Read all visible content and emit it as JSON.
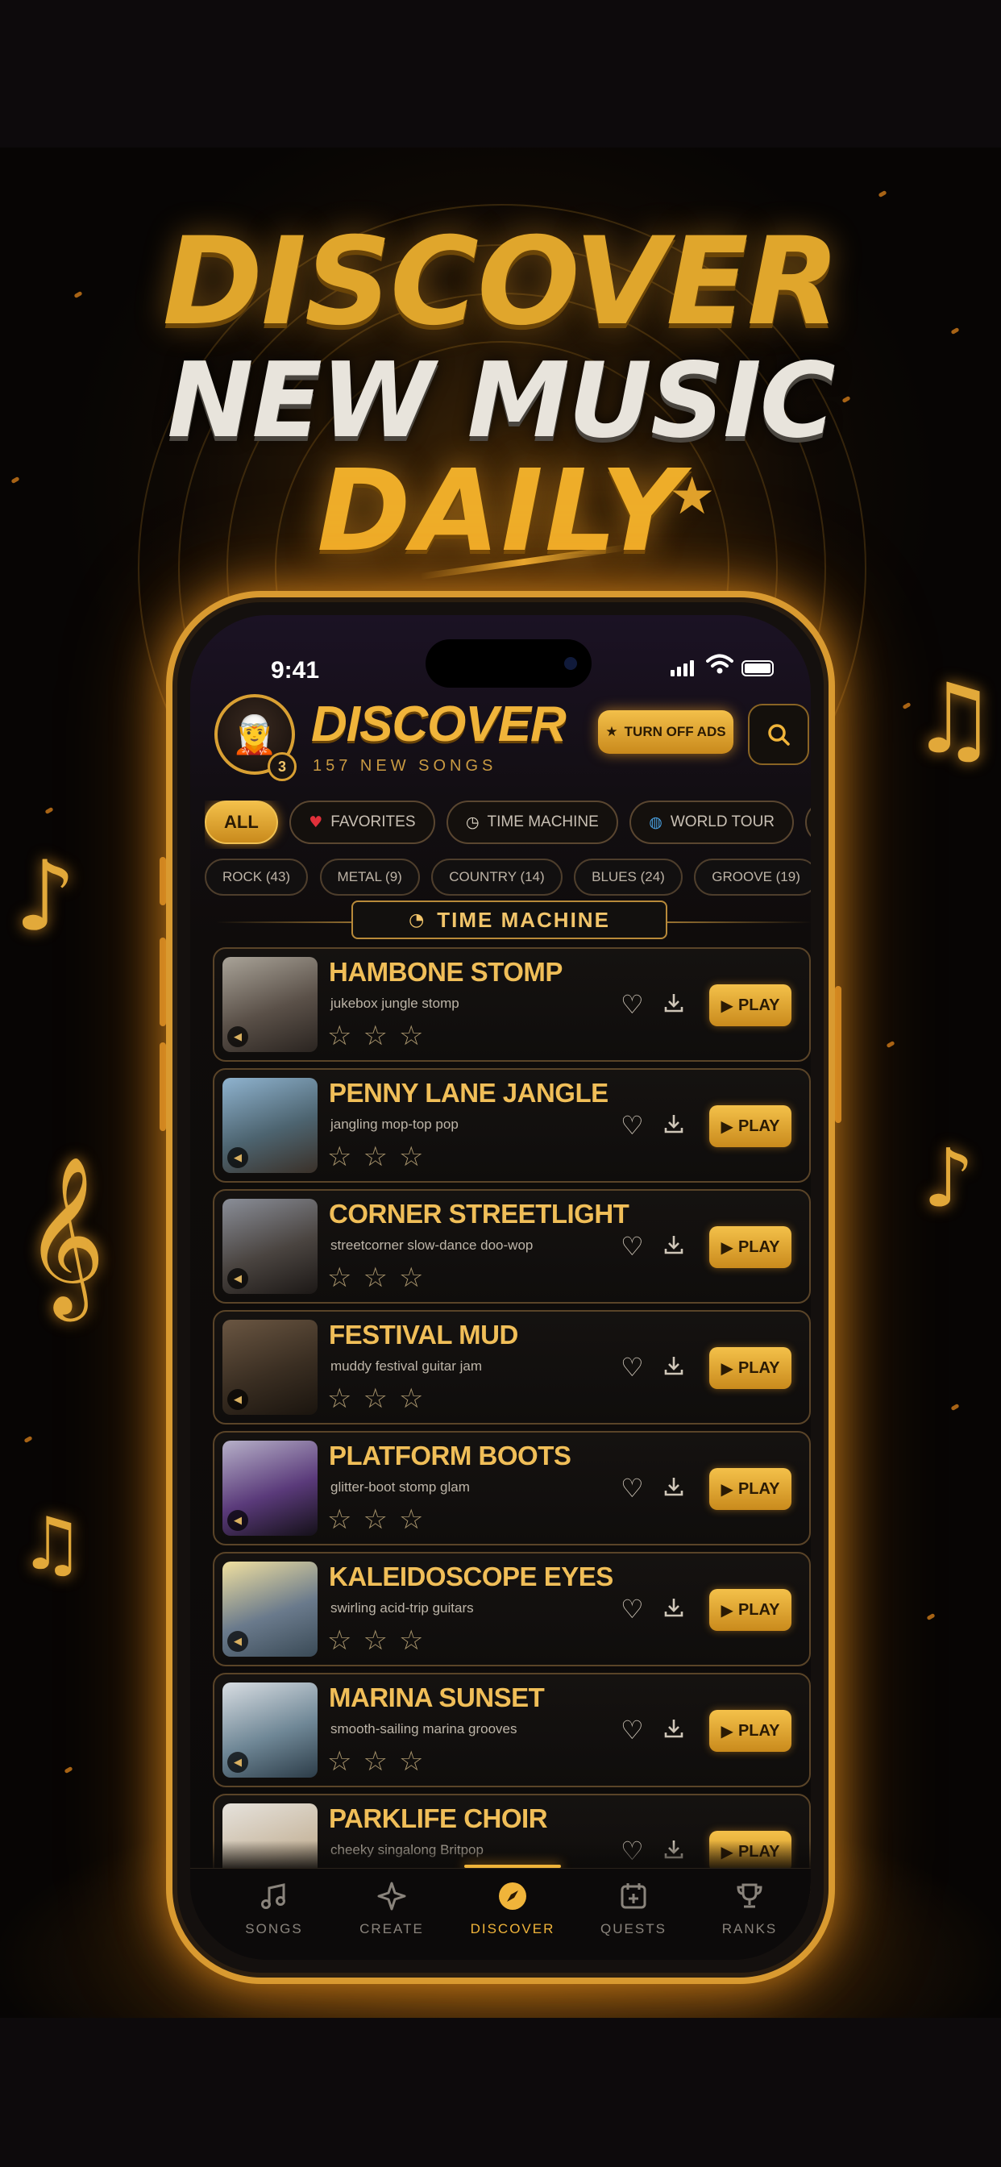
{
  "headline": {
    "line1": "DISCOVER",
    "line2": "NEW MUSIC",
    "line3": "DAILY"
  },
  "status": {
    "time": "9:41"
  },
  "header": {
    "title": "DISCOVER",
    "subtitle": "157 NEW SONGS",
    "level": "3",
    "ads_button": "TURN OFF ADS"
  },
  "categories": [
    {
      "label": "ALL",
      "icon": ""
    },
    {
      "label": "FAVORITES",
      "icon": "heart-icon"
    },
    {
      "label": "TIME MACHINE",
      "icon": "clock-icon"
    },
    {
      "label": "WORLD TOUR",
      "icon": "globe-icon"
    },
    {
      "label": "C",
      "icon": "card-icon"
    }
  ],
  "genres": [
    "ROCK (43)",
    "METAL (9)",
    "COUNTRY (14)",
    "BLUES (24)",
    "GROOVE (19)",
    "WO"
  ],
  "section": {
    "label": "TIME MACHINE"
  },
  "songs": [
    {
      "title": "HAMBONE STOMP",
      "desc": "jukebox jungle stomp",
      "play": "PLAY",
      "colors": [
        "#a9a398",
        "#5a5048",
        "#2a2420"
      ]
    },
    {
      "title": "PENNY LANE JANGLE",
      "desc": "jangling mop-top pop",
      "play": "PLAY",
      "colors": [
        "#8fb3cf",
        "#4d6470",
        "#3a3028"
      ]
    },
    {
      "title": "CORNER STREETLIGHT",
      "desc": "streetcorner slow-dance doo-wop",
      "play": "PLAY",
      "colors": [
        "#8a8e98",
        "#4a4440",
        "#1c1816"
      ]
    },
    {
      "title": "FESTIVAL MUD",
      "desc": "muddy festival guitar jam",
      "play": "PLAY",
      "colors": [
        "#6a5642",
        "#3a2e22",
        "#1a140e"
      ]
    },
    {
      "title": "PLATFORM BOOTS",
      "desc": "glitter-boot stomp glam",
      "play": "PLAY",
      "colors": [
        "#b6b0c8",
        "#5a3a7a",
        "#141018"
      ]
    },
    {
      "title": "KALEIDOSCOPE EYES",
      "desc": "swirling acid-trip guitars",
      "play": "PLAY",
      "colors": [
        "#f0e0a0",
        "#6a7a8c",
        "#3a4a56"
      ]
    },
    {
      "title": "MARINA SUNSET",
      "desc": "smooth-sailing marina grooves",
      "play": "PLAY",
      "colors": [
        "#d8dde2",
        "#6f8796",
        "#2c3c48"
      ]
    },
    {
      "title": "PARKLIFE CHOIR",
      "desc": "cheeky singalong Britpop",
      "play": "PLAY",
      "colors": [
        "#e6e2dc",
        "#c8b8a0",
        "#8a7a64"
      ]
    }
  ],
  "tabs": [
    {
      "label": "SONGS",
      "icon": "music-note-icon"
    },
    {
      "label": "CREATE",
      "icon": "sparkle-icon"
    },
    {
      "label": "DISCOVER",
      "icon": "compass-icon"
    },
    {
      "label": "QUESTS",
      "icon": "calendar-plus-icon"
    },
    {
      "label": "RANKS",
      "icon": "trophy-icon"
    }
  ],
  "colors": {
    "accent": "#f0b43a",
    "background": "#0c0a09",
    "card_border": "#5a4428"
  }
}
